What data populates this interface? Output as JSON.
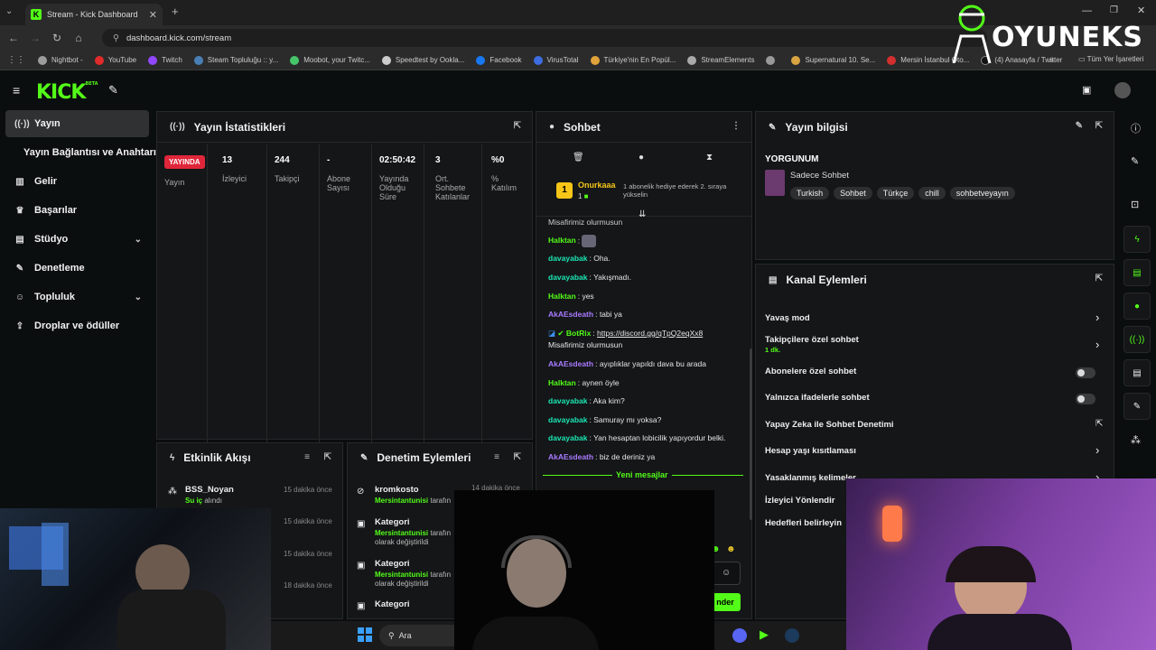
{
  "browser": {
    "tab_title": "Stream - Kick Dashboard",
    "url": "dashboard.kick.com/stream",
    "bookmarks": [
      "Nightbot -",
      "YouTube",
      "Twitch",
      "Steam Topluluğu :: y...",
      "Moobot, your Twitc...",
      "Speedtest by Ookla...",
      "Facebook",
      "VirusTotal",
      "Türkiye'nin En Popül...",
      "StreamElements",
      "",
      "Supernatural 10. Se...",
      "Mersin İstanbul Oto...",
      "(4) Anasayfa / Twitter"
    ],
    "all_bookmarks": "Tüm Yer İşaretleri"
  },
  "watermark": "OYUNEKS",
  "brand": {
    "logo": "KICK",
    "beta": "BETA",
    "accent": "#53fc18"
  },
  "sidebar": {
    "items": [
      {
        "label": "Yayın",
        "icon": "broadcast-icon"
      },
      {
        "label": "Yayın Bağlantısı ve Anahtarı"
      },
      {
        "label": "Gelir",
        "icon": "revenue-icon"
      },
      {
        "label": "Başarılar",
        "icon": "trophy-icon"
      },
      {
        "label": "Stüdyo",
        "icon": "studio-icon"
      },
      {
        "label": "Denetleme",
        "icon": "wrench-icon"
      },
      {
        "label": "Topluluk",
        "icon": "community-icon"
      },
      {
        "label": "Droplar ve ödüller",
        "icon": "drops-icon"
      }
    ]
  },
  "stats": {
    "title": "Yayın İstatistikleri",
    "live_badge": "YAYINDA",
    "cols": [
      {
        "value": "",
        "label": "Yayın"
      },
      {
        "value": "13",
        "label": "İzleyici"
      },
      {
        "value": "244",
        "label": "Takipçi"
      },
      {
        "value": "-",
        "label": "Abone Sayısı"
      },
      {
        "value": "02:50:42",
        "label": "Yayında Olduğu Süre"
      },
      {
        "value": "3",
        "label": "Ort. Sohbete Katılanlar"
      },
      {
        "value": "%0",
        "label": "% Katılım"
      }
    ]
  },
  "chat": {
    "title": "Sohbet",
    "pinned_user": "Onurkaaa",
    "pinned_level": "1",
    "pinned_text": "1 abonelik hediye ederek 2. sıraya yükselin",
    "truncated_top": "Misafirimiz olurmusun",
    "messages": [
      {
        "user": "Halktan",
        "text": "",
        "color": "#53fc18"
      },
      {
        "user": "davayabak",
        "text": "Oha.",
        "color": "#1ce6b4"
      },
      {
        "user": "davayabak",
        "text": "Yakışmadı.",
        "color": "#1ce6b4"
      },
      {
        "user": "Halktan",
        "text": "yes",
        "color": "#53fc18"
      },
      {
        "user": "AkAEsdeath",
        "text": "tabi ya",
        "color": "#a97bff"
      },
      {
        "user": "BotRix",
        "text": "https://discord.gg/qTpQ2eqXx8",
        "color": "#53fc18"
      },
      {
        "user": "",
        "text": "Misafirimiz olurmusun",
        "color": ""
      },
      {
        "user": "AkAEsdeath",
        "text": "ayıplıklar yapıldı dava bu arada",
        "color": "#a97bff"
      },
      {
        "user": "Halktan",
        "text": "aynen öyle",
        "color": "#53fc18"
      },
      {
        "user": "davayabak",
        "text": "Aka kim?",
        "color": "#1ce6b4"
      },
      {
        "user": "davayabak",
        "text": "Samuray mı yoksa?",
        "color": "#1ce6b4"
      },
      {
        "user": "davayabak",
        "text": "Yan hesaptan lobicilik yapıyordur belki.",
        "color": "#1ce6b4"
      },
      {
        "user": "AkAEsdeath",
        "text": "biz de deriniz ya",
        "color": "#a97bff"
      }
    ],
    "new_messages": "Yeni mesajlar",
    "send_label": "nder"
  },
  "stream_info": {
    "title": "Yayın bilgisi",
    "stream_title": "YORGUNUM",
    "category": "Sadece Sohbet",
    "tags": [
      "Turkish",
      "Sohbet",
      "Türkçe",
      "chill",
      "sohbetveyayın"
    ]
  },
  "channel_actions": {
    "title": "Kanal Eylemleri",
    "rows": [
      {
        "label": "Yavaş mod",
        "sub": "",
        "control": "chevron"
      },
      {
        "label": "Takipçilere özel sohbet",
        "sub": "1 dk.",
        "control": "chevron"
      },
      {
        "label": "Abonelere özel sohbet",
        "sub": "",
        "control": "toggle"
      },
      {
        "label": "Yalnızca ifadelerle sohbet",
        "sub": "",
        "control": "toggle"
      },
      {
        "label": "Yapay Zeka ile Sohbet Denetimi",
        "sub": "",
        "control": "external"
      },
      {
        "label": "Hesap yaşı kısıtlaması",
        "sub": "",
        "control": "chevron"
      },
      {
        "label": "Yasaklanmış kelimeler",
        "sub": "",
        "control": "chevron"
      },
      {
        "label": "İzleyici Yönlendir",
        "sub": "",
        "control": ""
      },
      {
        "label": "Hedefleri belirleyin",
        "sub": "",
        "control": ""
      }
    ]
  },
  "activity": {
    "title": "Etkinlik Akışı",
    "items": [
      {
        "user": "BSS_Noyan",
        "action": "Su iç",
        "suffix": " alındı",
        "time": "15 dakika önce"
      },
      {
        "user": "",
        "action": "",
        "suffix": "",
        "time": "15 dakika önce"
      },
      {
        "user": "",
        "action": "",
        "suffix": "",
        "time": "15 dakika önce"
      },
      {
        "user": "",
        "action": "",
        "suffix": "",
        "time": "18 dakika önce"
      }
    ]
  },
  "moderation": {
    "title": "Denetim Eylemleri",
    "items": [
      {
        "title": "kromkosto",
        "by": "Mersintantunisi",
        "text": " tarafın",
        "time": "14 dakika önce"
      },
      {
        "title": "Kategori",
        "by": "Mersintantunisi",
        "text": " tarafın",
        "line2": "olarak değiştirildi"
      },
      {
        "title": "Kategori",
        "by": "Mersintantunisi",
        "text": " tarafın",
        "line2": "olarak değiştirildi"
      },
      {
        "title": "Kategori",
        "by": "",
        "text": "",
        "line2": ""
      }
    ]
  },
  "taskbar": {
    "search": "Ara"
  }
}
